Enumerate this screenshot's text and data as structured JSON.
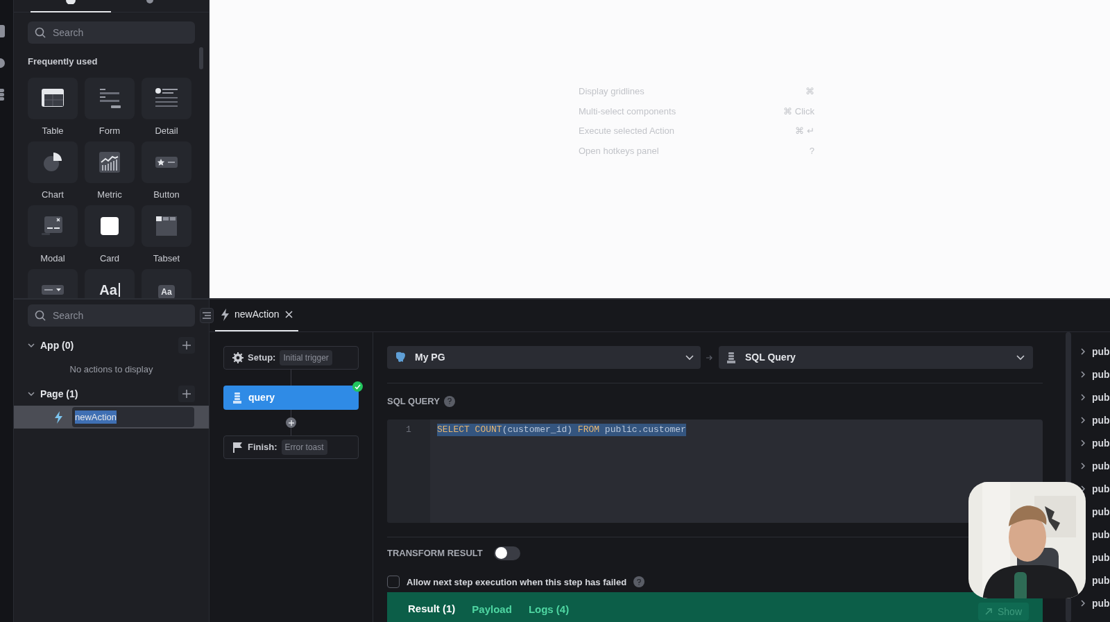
{
  "component_panel": {
    "tabs": [
      {
        "selected": true
      },
      {
        "selected": false
      }
    ],
    "search": {
      "placeholder": "Search"
    },
    "section_title": "Frequently used",
    "components": [
      {
        "kind": "table",
        "label": "Table"
      },
      {
        "kind": "form",
        "label": "Form"
      },
      {
        "kind": "detail",
        "label": "Detail"
      },
      {
        "kind": "chart",
        "label": "Chart"
      },
      {
        "kind": "metric",
        "label": "Metric"
      },
      {
        "kind": "button",
        "label": "Button"
      },
      {
        "kind": "modal",
        "label": "Modal"
      },
      {
        "kind": "card",
        "label": "Card"
      },
      {
        "kind": "tabset",
        "label": "Tabset"
      },
      {
        "kind": "select"
      },
      {
        "kind": "text",
        "glyph": "Aa"
      },
      {
        "kind": "labeled-text",
        "glyph": "Aa"
      }
    ]
  },
  "canvas": {
    "hotkeys": [
      {
        "action": "Display gridlines",
        "keys": "⌘"
      },
      {
        "action": "Multi-select components",
        "keys": "⌘ Click"
      },
      {
        "action": "Execute selected Action",
        "keys": "⌘ ↵"
      },
      {
        "action": "Open hotkeys panel",
        "keys": "?"
      }
    ]
  },
  "actions_panel": {
    "search": {
      "placeholder": "Search"
    },
    "groups": [
      {
        "label": "App (0)",
        "expanded": true,
        "empty_text": "No actions to display"
      },
      {
        "label": "Page (1)",
        "expanded": true,
        "items": [
          {
            "name": "newAction",
            "editing": true
          }
        ]
      }
    ]
  },
  "editor_tabs": [
    {
      "label": "newAction",
      "selected": true
    }
  ],
  "flow": {
    "setup": {
      "label": "Setup:",
      "value": "Initial trigger"
    },
    "step": {
      "name": "query",
      "success": true
    },
    "finish": {
      "label": "Finish:",
      "value": "Error toast"
    }
  },
  "datasource": {
    "value": "My PG"
  },
  "query_type": {
    "value": "SQL Query"
  },
  "sql_query": {
    "label": "SQL QUERY",
    "selected": true,
    "lines": [
      {
        "number": "1",
        "tokens": [
          {
            "text": "SELECT ",
            "kind": "keyword"
          },
          {
            "text": "COUNT",
            "kind": "keyword"
          },
          {
            "text": "(customer_id) ",
            "kind": "plain"
          },
          {
            "text": "FROM ",
            "kind": "keyword"
          },
          {
            "text": "public.customer",
            "kind": "plain"
          }
        ]
      }
    ]
  },
  "transform_result": {
    "label": "TRANSFORM RESULT",
    "on": false
  },
  "allow_next": {
    "label": "Allow next step execution when this step has failed",
    "checked": false
  },
  "result_tabs": [
    {
      "label": "Result (1)",
      "selected": true
    },
    {
      "label": "Payload",
      "selected": false
    },
    {
      "label": "Logs (4)",
      "selected": false
    }
  ],
  "show_button": {
    "label": "Show"
  },
  "schema_list": [
    {
      "label": "pub",
      "expander": true
    },
    {
      "label": "pub",
      "expander": true
    },
    {
      "label": "pub",
      "expander": true
    },
    {
      "label": "pub",
      "expander": true
    },
    {
      "label": "pub",
      "expander": true
    },
    {
      "label": "pub",
      "expander": true
    },
    {
      "label": "pub",
      "expander": true
    },
    {
      "label": "pub",
      "expander": false
    },
    {
      "label": "pub",
      "expander": false
    },
    {
      "label": "pub",
      "expander": false
    },
    {
      "label": "pub",
      "expander": false
    },
    {
      "label": "pub",
      "expander": true
    }
  ]
}
